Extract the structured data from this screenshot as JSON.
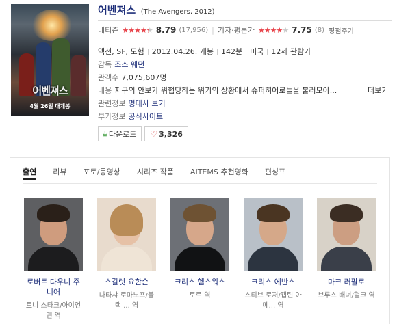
{
  "movie": {
    "title": "어벤져스",
    "original_title": "(The Avengers, 2012)",
    "poster_title": "어벤져스",
    "poster_date": "4월 26일 대개봉",
    "netizen_label": "네티즌",
    "netizen_score": "8.79",
    "netizen_count": "(17,956)",
    "netizen_stars": 4.5,
    "critic_label": "기자·평론가",
    "critic_score": "7.75",
    "critic_count": "(8)",
    "critic_stars": 4,
    "rate_link": "평점주기",
    "genre": "액션, SF, 모험",
    "release_date": "2012.04.26. 개봉",
    "runtime": "142분",
    "country": "미국",
    "age_rating": "12세 관람가",
    "director_label": "감독",
    "director": "조스 웨던",
    "audience_label": "관객수",
    "audience": "7,075,607명",
    "plot_label": "내용",
    "plot": "지구의 안보가 위협당하는 위기의 상황에서 슈퍼히어로들을 불러모아...",
    "more_link": "더보기",
    "related_label": "관련정보",
    "related_link": "명대사 보기",
    "extra_label": "부가정보",
    "extra_link": "공식사이트"
  },
  "actions": {
    "download_label": "다운로드",
    "likes": "3,326"
  },
  "tabs": [
    {
      "label": "출연",
      "active": true
    },
    {
      "label": "리뷰"
    },
    {
      "label": "포토/동영상"
    },
    {
      "label": "시리즈 작품"
    },
    {
      "label": "AITEMS 추천영화"
    },
    {
      "label": "편성표"
    }
  ],
  "cast": [
    {
      "name": "로버트 다우니 주니어",
      "role": "토니 스타크/아이언 맨 역"
    },
    {
      "name": "스칼렛 요한슨",
      "role": "나타샤 로마노프/블랙 ... 역"
    },
    {
      "name": "크리스 헴스워스",
      "role": "토르 역"
    },
    {
      "name": "크리스 에반스",
      "role": "스티브 로저/캡틴 아메... 역"
    },
    {
      "name": "마크 러팔로",
      "role": "브루스 배너/헐크 역"
    }
  ],
  "colors": {
    "title": "#1e2f7a",
    "stars": "#e8434a",
    "download_icon": "#3b9a3b"
  }
}
